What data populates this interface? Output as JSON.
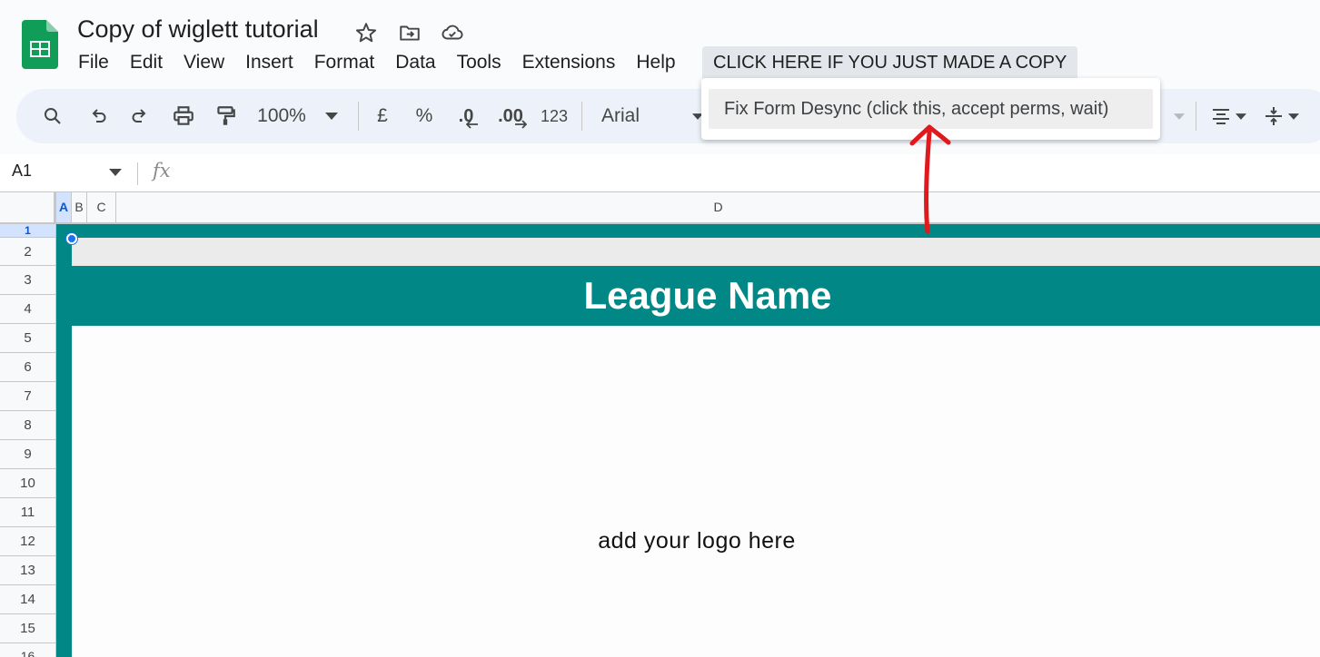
{
  "header": {
    "title": "Copy of wiglett tutorial",
    "icons": [
      "star-icon",
      "move-to-folder-icon",
      "cloud-saved-icon"
    ]
  },
  "menu": {
    "items": [
      "File",
      "Edit",
      "View",
      "Insert",
      "Format",
      "Data",
      "Tools",
      "Extensions",
      "Help"
    ],
    "custom": "CLICK HERE IF YOU JUST MADE A COPY"
  },
  "dropdown": {
    "item": "Fix Form Desync (click this, accept perms, wait)"
  },
  "toolbar": {
    "zoom": "100%",
    "currency": "£",
    "percent": "%",
    "decrease_decimal": ".0",
    "increase_decimal": ".00",
    "more_formats": "123",
    "font": "Arial"
  },
  "formula_bar": {
    "cell_ref": "A1",
    "fx": "fx"
  },
  "grid": {
    "columns": [
      "A",
      "B",
      "C",
      "D"
    ],
    "rows": [
      "1",
      "2",
      "3",
      "4",
      "5",
      "6",
      "7",
      "8",
      "9",
      "10",
      "11",
      "12",
      "13",
      "14",
      "15",
      "16"
    ]
  },
  "sheet": {
    "league_name": "League Name",
    "logo_placeholder": "add your logo here"
  },
  "colors": {
    "teal": "#018786",
    "sheets_green": "#0f9d58",
    "selection_blue": "#1a73e8",
    "annotation_red": "#e0191e"
  }
}
